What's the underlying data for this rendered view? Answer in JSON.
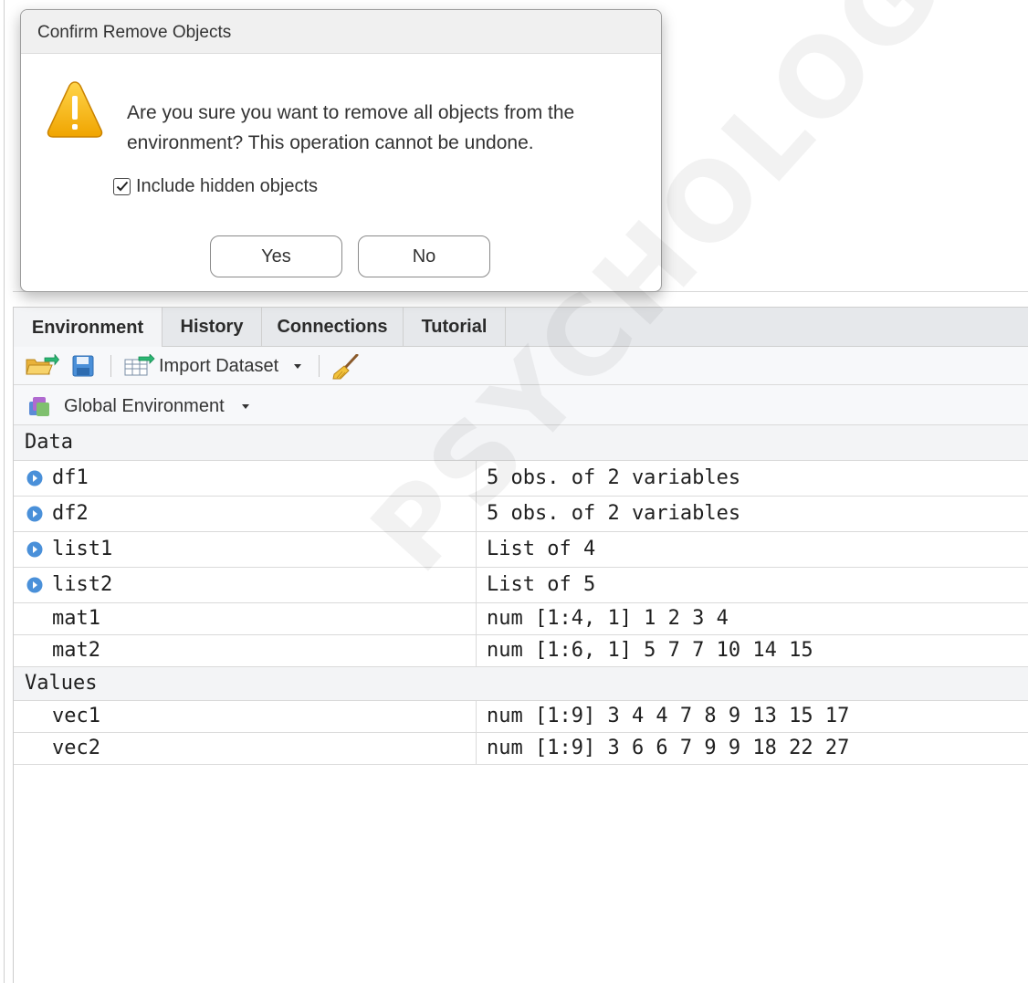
{
  "dialog": {
    "title": "Confirm Remove Objects",
    "message_line1": "Are you sure you want to remove all objects from the",
    "message_line2": "environment? This operation cannot be undone.",
    "checkbox_label": "Include hidden objects",
    "checkbox_checked": true,
    "yes_label": "Yes",
    "no_label": "No"
  },
  "tabs": [
    {
      "label": "Environment",
      "active": true
    },
    {
      "label": "History",
      "active": false
    },
    {
      "label": "Connections",
      "active": false
    },
    {
      "label": "Tutorial",
      "active": false
    }
  ],
  "toolbar": {
    "import_label": "Import Dataset",
    "icons": [
      "open-folder-icon",
      "save-icon",
      "import-dataset-icon",
      "broom-icon"
    ]
  },
  "environment_selector": {
    "label": "Global Environment"
  },
  "sections": {
    "data_label": "Data",
    "values_label": "Values"
  },
  "data_rows": [
    {
      "name": "df1",
      "value": "5 obs. of 2 variables",
      "expandable": true
    },
    {
      "name": "df2",
      "value": "5 obs. of 2 variables",
      "expandable": true
    },
    {
      "name": "list1",
      "value": "List of 4",
      "expandable": true
    },
    {
      "name": "list2",
      "value": "List of 5",
      "expandable": true
    },
    {
      "name": "mat1",
      "value": "num [1:4, 1] 1 2 3 4",
      "expandable": false
    },
    {
      "name": "mat2",
      "value": "num [1:6, 1] 5 7 7 10 14 15",
      "expandable": false
    }
  ],
  "value_rows": [
    {
      "name": "vec1",
      "value": "num [1:9] 3 4 4 7 8 9 13 15 17"
    },
    {
      "name": "vec2",
      "value": "num [1:9] 3 6 6 7 9 9 18 22 27"
    }
  ],
  "watermark": "PSYCHOLOGY.COM",
  "colors": {
    "warning_yellow": "#f5b400",
    "expand_blue": "#4a90d9",
    "tab_bar": "#e6e8eb"
  }
}
